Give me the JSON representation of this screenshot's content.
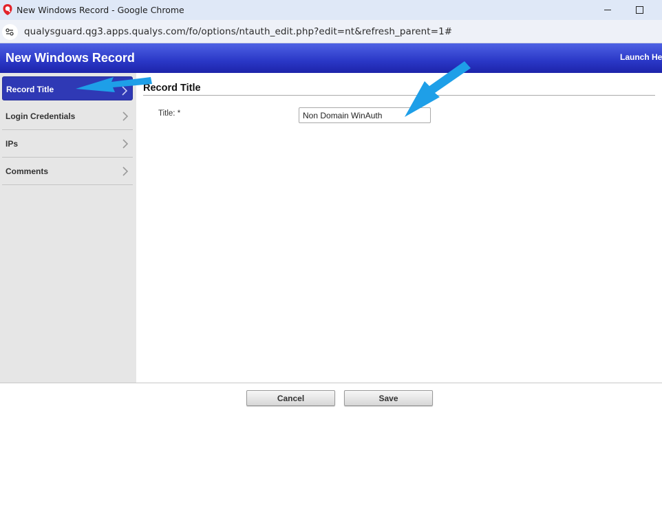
{
  "browser": {
    "window_title": "New Windows Record - Google Chrome",
    "url": "qualysguard.qg3.apps.qualys.com/fo/options/ntauth_edit.php?edit=nt&refresh_parent=1#"
  },
  "app": {
    "title": "New Windows Record",
    "launch_help": "Launch Hel",
    "header_color": "#2a37c6"
  },
  "sidebar": {
    "items": [
      {
        "label": "Record Title",
        "active": true
      },
      {
        "label": "Login Credentials",
        "active": false
      },
      {
        "label": "IPs",
        "active": false
      },
      {
        "label": "Comments",
        "active": false
      }
    ]
  },
  "main": {
    "section_title": "Record Title",
    "fields": [
      {
        "label": "Title: *",
        "value": "Non Domain WinAuth"
      }
    ]
  },
  "footer": {
    "cancel_label": "Cancel",
    "save_label": "Save"
  },
  "annotations": {
    "arrow_color": "#1e9fe8"
  }
}
